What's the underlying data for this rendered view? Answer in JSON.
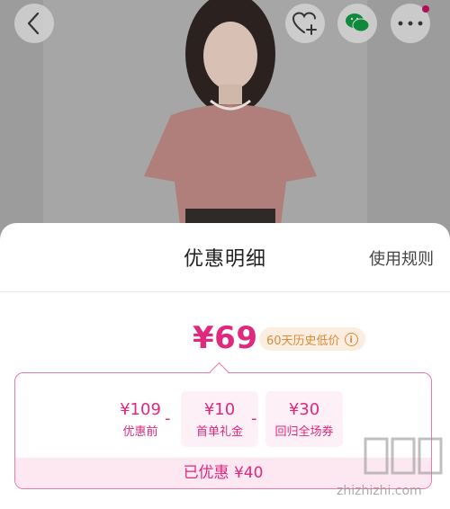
{
  "header": {
    "back_icon": "chevron-left-icon",
    "favorite_icon": "heart-plus-icon",
    "chat_icon": "wechat-icon",
    "more_icon": "more-dots-icon"
  },
  "sheet": {
    "title": "优惠明细",
    "rules_label": "使用规则",
    "final_price": "¥69",
    "history_badge": "60天历史低价",
    "breakdown": [
      {
        "amount": "¥109",
        "label": "优惠前"
      },
      {
        "amount": "¥10",
        "label": "首单礼金"
      },
      {
        "amount": "¥30",
        "label": "回归全场券"
      }
    ],
    "operator": "-",
    "saved_text": "已优惠 ¥40"
  },
  "watermark": {
    "logo": "值值值",
    "text": "zhizhizhi.com"
  },
  "colors": {
    "accent": "#e0287d",
    "badge_bg": "#fbeee1",
    "badge_text": "#d98a3a",
    "tile_bg": "#fdf0f6"
  }
}
